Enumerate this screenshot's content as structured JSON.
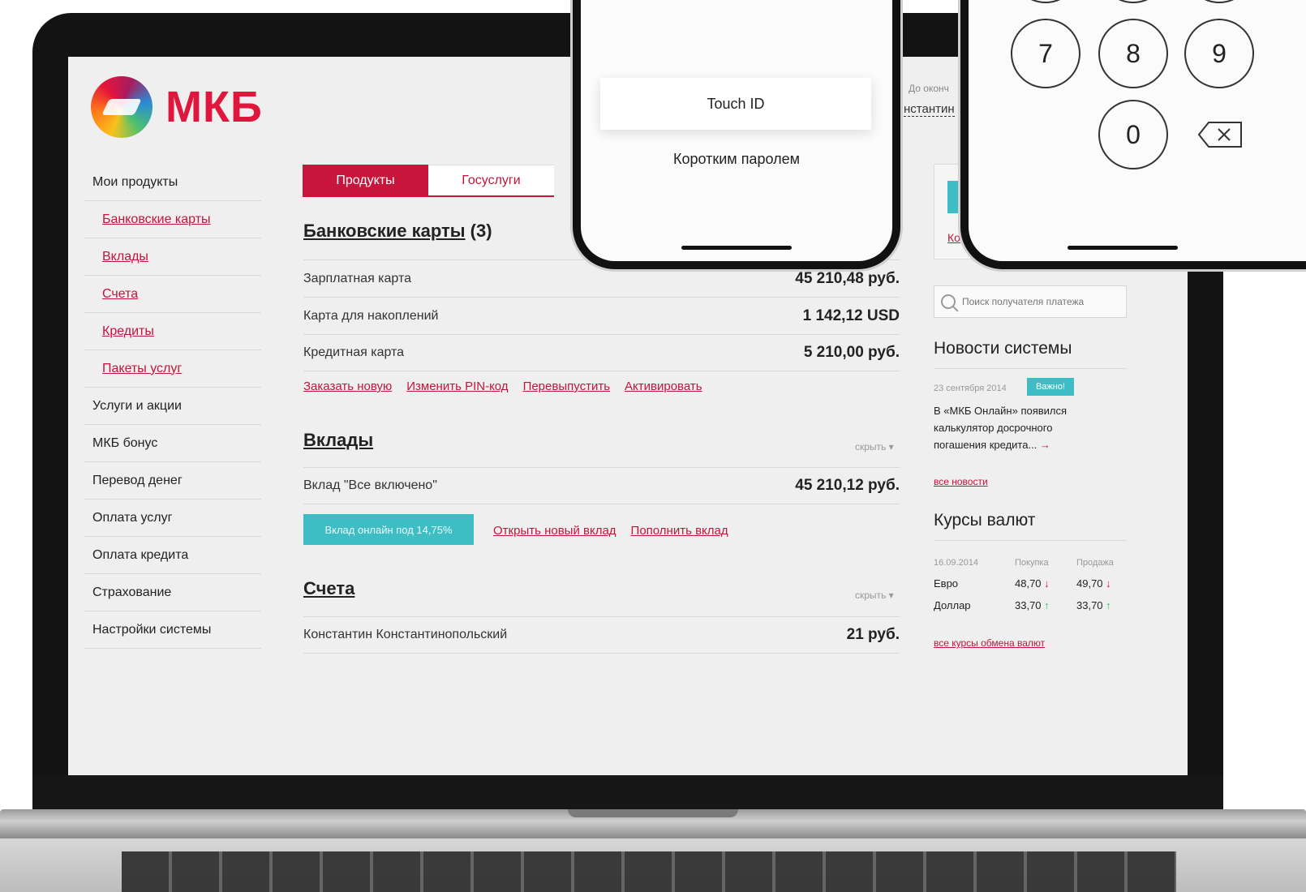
{
  "brand": {
    "name": "МКБ"
  },
  "sidebar": {
    "items": [
      {
        "label": "Мои продукты",
        "sub": false
      },
      {
        "label": "Банковские карты",
        "sub": true
      },
      {
        "label": "Вклады",
        "sub": true
      },
      {
        "label": "Счета",
        "sub": true
      },
      {
        "label": "Кредиты",
        "sub": true
      },
      {
        "label": "Пакеты услуг",
        "sub": true
      },
      {
        "label": "Услуги и акции",
        "sub": false
      },
      {
        "label": "МКБ бонус",
        "sub": false
      },
      {
        "label": "Перевод денег",
        "sub": false
      },
      {
        "label": "Оплата услуг",
        "sub": false
      },
      {
        "label": "Оплата кредита",
        "sub": false
      },
      {
        "label": "Страхование",
        "sub": false
      },
      {
        "label": "Настройки системы",
        "sub": false
      }
    ]
  },
  "tabs": [
    {
      "label": "Продукты",
      "active": true
    },
    {
      "label": "Госуслуги",
      "active": false
    }
  ],
  "cards": {
    "title": "Банковские карты",
    "count": "(3)",
    "rows": [
      {
        "name": "Зарплатная карта",
        "value": "45 210,48 руб."
      },
      {
        "name": "Карта для накоплений",
        "value": "1 142,12 USD"
      },
      {
        "name": "Кредитная карта",
        "value": "5 210,00 руб."
      }
    ],
    "links": [
      "Заказать новую",
      "Изменить PIN-код",
      "Перевыпустить",
      "Активировать"
    ]
  },
  "deposits": {
    "title": "Вклады",
    "hide": "скрыть ▾",
    "rows": [
      {
        "name": "Вклад \"Все включено\"",
        "value": "45 210,12 руб."
      }
    ],
    "button": "Вклад онлайн под 14,75%",
    "links": [
      "Открыть новый вклад",
      "Пополнить вклад"
    ]
  },
  "accounts": {
    "title": "Счета",
    "hide": "скрыть ▾",
    "rows": [
      {
        "name": "Константин Константинопольский",
        "value": "21 руб."
      }
    ]
  },
  "header_right": {
    "note": "До оконч",
    "name": "нстантин"
  },
  "promo": {
    "link": "Ко"
  },
  "search": {
    "placeholder": "Поиск получателя платежа"
  },
  "news": {
    "title": "Новости системы",
    "date": "23 сентября 2014",
    "badge": "Важно!",
    "text": "В «МКБ Онлайн» появился калькулятор досрочного погашения кредита...",
    "arrow": "→",
    "all_link": "все новости"
  },
  "rates": {
    "title": "Курсы валют",
    "date": "16.09.2014",
    "col_buy": "Покупка",
    "col_sell": "Продажа",
    "rows": [
      {
        "currency": "Евро",
        "buy": "48,70",
        "buy_dir": "↓",
        "sell": "49,70",
        "sell_dir": "↓"
      },
      {
        "currency": "Доллар",
        "buy": "33,70",
        "buy_dir": "↑",
        "sell": "33,70",
        "sell_dir": "↑"
      }
    ],
    "all_link": "все курсы обмена валют"
  },
  "phone_login": {
    "touch_id": "Touch ID",
    "short_password": "Коротким паролем"
  },
  "phone_keypad": {
    "keys": [
      "7",
      "8",
      "9",
      "0"
    ]
  },
  "colors": {
    "brand_red": "#c8153b",
    "teal": "#3fbdc4",
    "up": "#3fbd6a",
    "down": "#e0173c"
  }
}
